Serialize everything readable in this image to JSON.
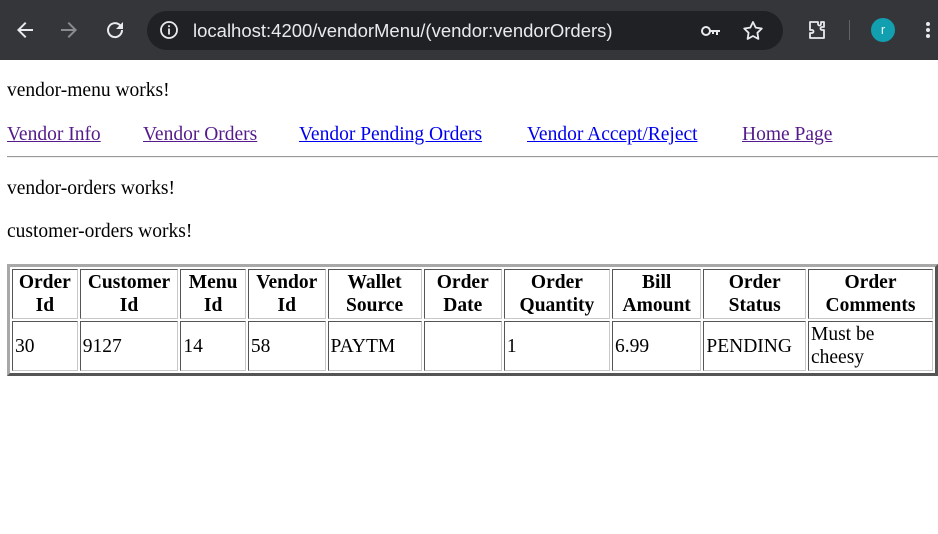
{
  "browser": {
    "url": "localhost:4200/vendorMenu/(vendor:vendorOrders)",
    "avatar_letter": "r"
  },
  "page": {
    "vendor_menu_text": "vendor-menu works!",
    "nav_links": [
      {
        "label": "Vendor Info",
        "visited": true
      },
      {
        "label": "Vendor Orders",
        "visited": true
      },
      {
        "label": "Vendor Pending Orders",
        "visited": false
      },
      {
        "label": "Vendor Accept/Reject",
        "visited": false
      },
      {
        "label": "Home Page",
        "visited": true
      }
    ],
    "vendor_orders_text": "vendor-orders works!",
    "customer_orders_text": "customer-orders works!"
  },
  "table": {
    "headers": [
      [
        "Order",
        "Id"
      ],
      [
        "Customer",
        "Id"
      ],
      [
        "Menu",
        "Id"
      ],
      [
        "Vendor",
        "Id"
      ],
      [
        "Wallet",
        "Source"
      ],
      [
        "Order",
        "Date"
      ],
      [
        "Order",
        "Quantity"
      ],
      [
        "Bill",
        "Amount"
      ],
      [
        "Order",
        "Status"
      ],
      [
        "Order",
        "Comments"
      ]
    ],
    "rows": [
      [
        [
          "30"
        ],
        [
          "9127"
        ],
        [
          "14"
        ],
        [
          "58"
        ],
        [
          "PAYTM"
        ],
        [
          ""
        ],
        [
          "1"
        ],
        [
          "6.99"
        ],
        [
          "PENDING"
        ],
        [
          "Must be",
          "cheesy"
        ]
      ]
    ]
  }
}
